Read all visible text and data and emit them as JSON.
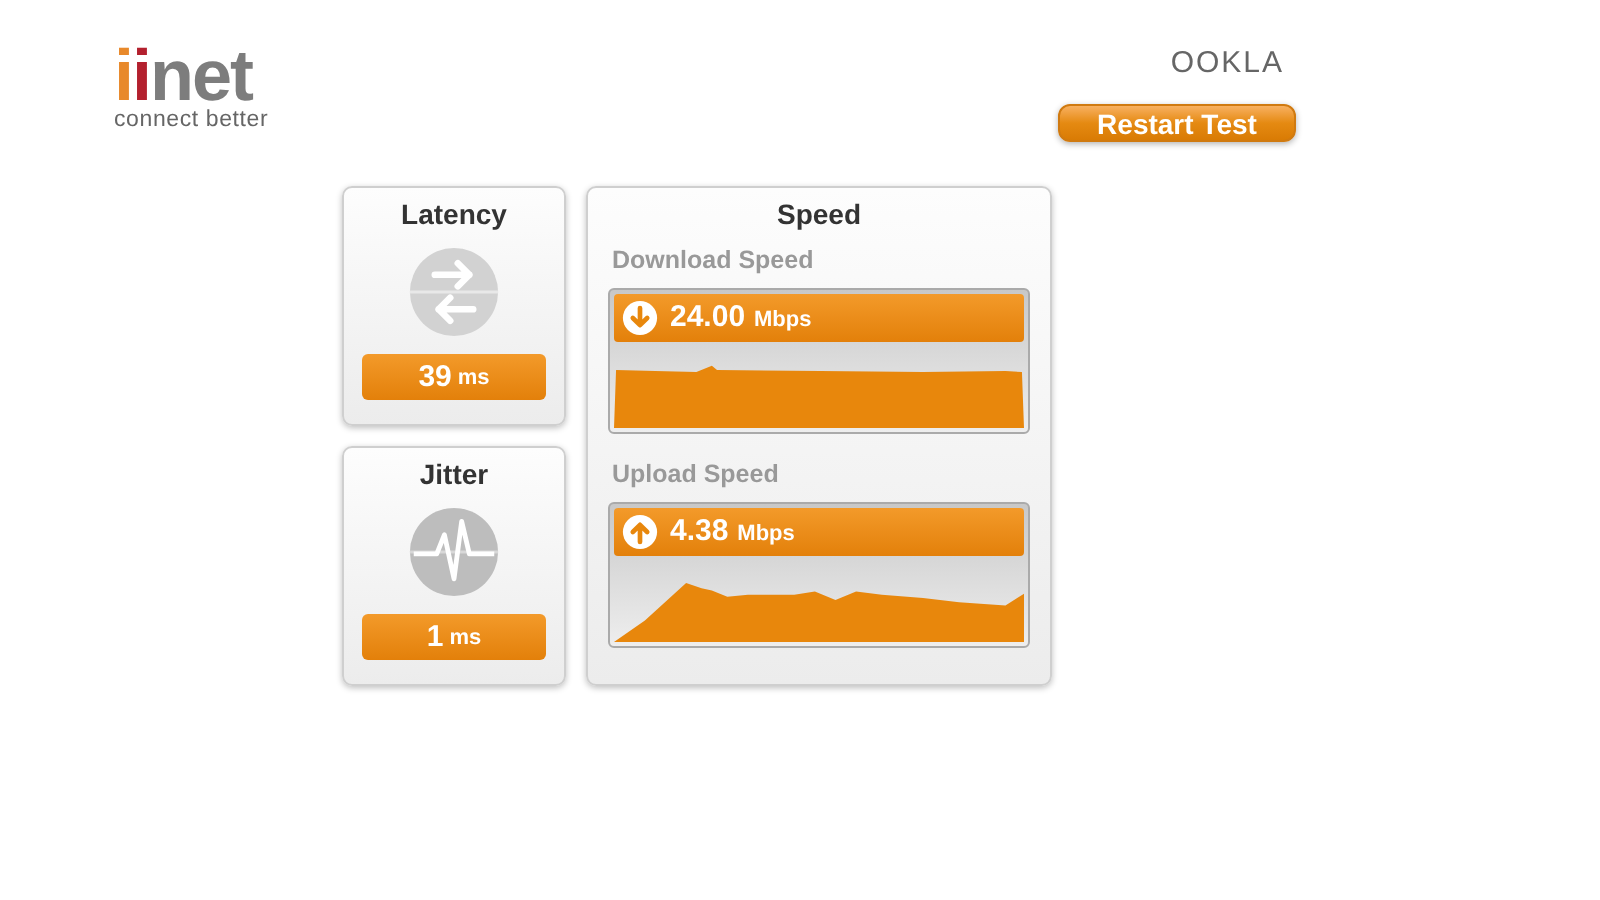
{
  "logo": {
    "letters": [
      {
        "text": "i",
        "color": "#e8892b"
      },
      {
        "text": "i",
        "color": "#b3202e"
      },
      {
        "text": "net",
        "color": "#7d7d7d"
      }
    ],
    "tagline": "connect better"
  },
  "partner_logo": "OOKLA",
  "restart_button": "Restart Test",
  "metrics": [
    {
      "kind": "latency",
      "title": "Latency",
      "value": "39",
      "unit": "ms"
    },
    {
      "kind": "jitter",
      "title": "Jitter",
      "value": "1",
      "unit": "ms"
    }
  ],
  "speed": {
    "title": "Speed",
    "tests": [
      {
        "kind": "download",
        "label": "Download Speed",
        "value": "24.00",
        "unit": "Mbps"
      },
      {
        "kind": "upload",
        "label": "Upload Speed",
        "value": "4.38",
        "unit": "Mbps"
      }
    ]
  }
}
